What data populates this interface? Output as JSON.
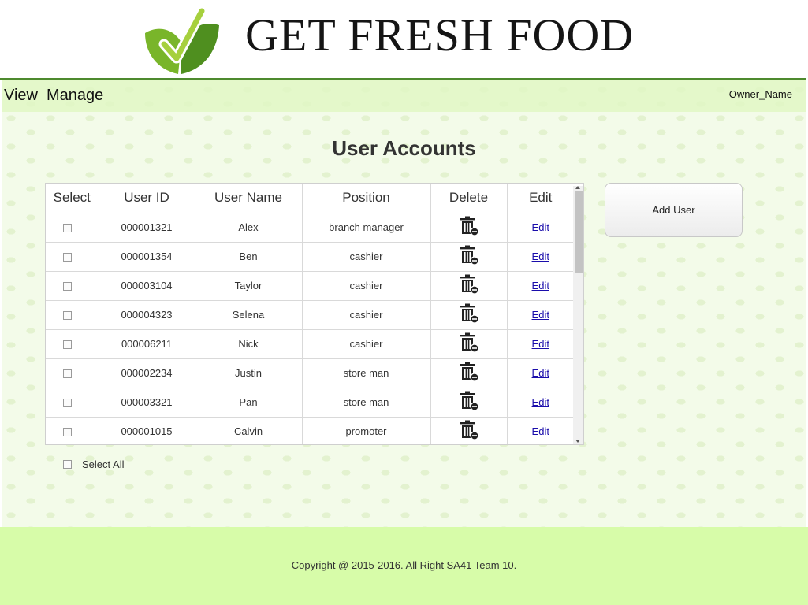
{
  "header": {
    "brand": "GET FRESH FOOD",
    "logo_icon": "checkmark-leaf-logo"
  },
  "nav": {
    "view_label": "View",
    "manage_label": "Manage",
    "owner_name": "Owner_Name"
  },
  "main": {
    "title": "User Accounts",
    "add_user_label": "Add User",
    "select_all_label": "Select All"
  },
  "table": {
    "headers": {
      "select": "Select",
      "user_id": "User ID",
      "user_name": "User Name",
      "position": "Position",
      "delete": "Delete",
      "edit": "Edit"
    },
    "rows": [
      {
        "user_id": "000001321",
        "user_name": "Alex",
        "position": "branch manager",
        "edit": "Edit"
      },
      {
        "user_id": "000001354",
        "user_name": "Ben",
        "position": "cashier",
        "edit": "Edit"
      },
      {
        "user_id": "000003104",
        "user_name": "Taylor",
        "position": "cashier",
        "edit": "Edit"
      },
      {
        "user_id": "000004323",
        "user_name": "Selena",
        "position": "cashier",
        "edit": "Edit"
      },
      {
        "user_id": "000006211",
        "user_name": "Nick",
        "position": "cashier",
        "edit": "Edit"
      },
      {
        "user_id": "000002234",
        "user_name": "Justin",
        "position": "store man",
        "edit": "Edit"
      },
      {
        "user_id": "000003321",
        "user_name": "Pan",
        "position": "store man",
        "edit": "Edit"
      },
      {
        "user_id": "000001015",
        "user_name": "Calvin",
        "position": "promoter",
        "edit": "Edit"
      }
    ],
    "delete_icon": "trash-icon"
  },
  "footer": {
    "copyright": "Copyright @ 2015-2016. All Right SA41 Team 10."
  },
  "colors": {
    "accent_green": "#4e8a2e",
    "nav_green": "#e1f7c4",
    "footer_green": "#d7fca9",
    "link_blue": "#1a0dab"
  }
}
